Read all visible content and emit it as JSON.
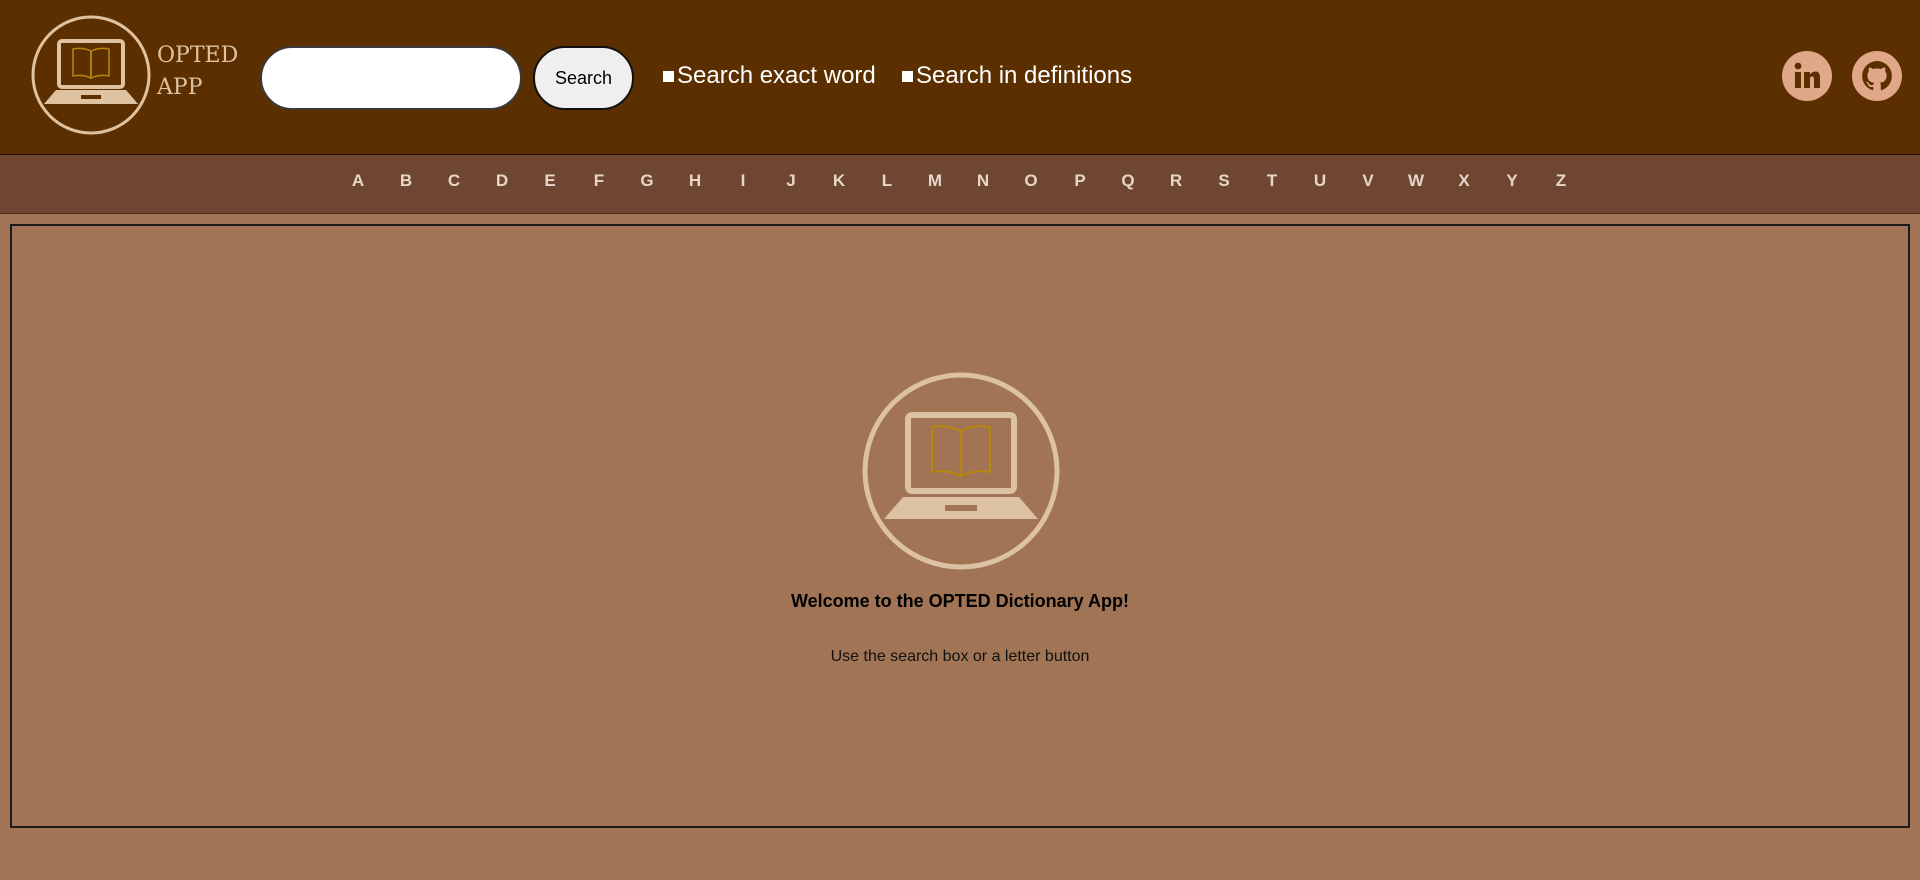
{
  "app": {
    "logo_line1": "OPTED",
    "logo_line2": "APP"
  },
  "search": {
    "value": "",
    "placeholder": "",
    "button_label": "Search",
    "options": {
      "exact_label": "Search exact word",
      "definitions_label": "Search in definitions"
    }
  },
  "social": {
    "linkedin_icon": "linkedin-icon",
    "github_icon": "github-icon"
  },
  "letters": [
    "A",
    "B",
    "C",
    "D",
    "E",
    "F",
    "G",
    "H",
    "I",
    "J",
    "K",
    "L",
    "M",
    "N",
    "O",
    "P",
    "Q",
    "R",
    "S",
    "T",
    "U",
    "V",
    "W",
    "X",
    "Y",
    "Z"
  ],
  "main": {
    "welcome": "Welcome to the OPTED Dictionary App!",
    "hint": "Use the search box or a letter button"
  },
  "colors": {
    "header_bg": "#5c2f00",
    "letter_bar_bg": "#6f4632",
    "page_bg": "#a07455",
    "logo_accent": "#dfc3a0",
    "book_accent": "#b8860b",
    "social_bg": "#e0a888"
  }
}
